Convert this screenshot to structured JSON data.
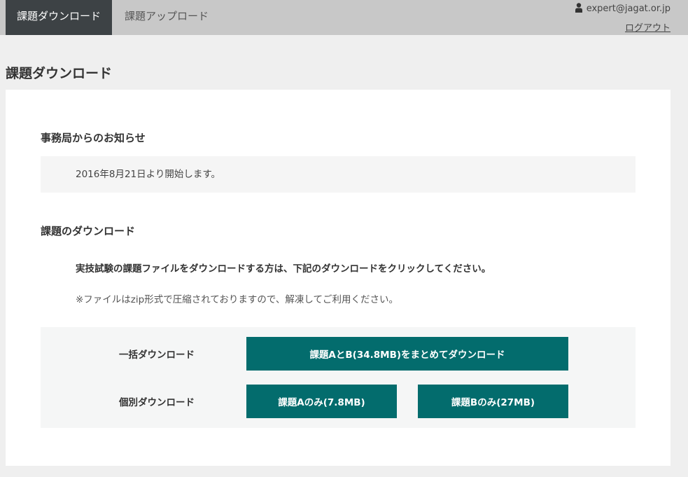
{
  "nav": {
    "tabs": [
      {
        "label": "課題ダウンロード",
        "active": true
      },
      {
        "label": "課題アップロード",
        "active": false
      }
    ],
    "user_icon": "user-icon",
    "user_email": "expert@jagat.or.jp",
    "logout_label": "ログアウト"
  },
  "page": {
    "title": "課題ダウンロード"
  },
  "notice_section": {
    "heading": "事務局からのお知らせ",
    "message": "2016年8月21日より開始します。"
  },
  "download_section": {
    "heading": "課題のダウンロード",
    "lead": "実技試験の課題ファイルをダウンロードする方は、下記のダウンロードをクリックしてください。",
    "note": "※ファイルはzip形式で圧縮されておりますので、解凍してご利用ください。",
    "bulk_label": "一括ダウンロード",
    "bulk_button": "課題AとB(34.8MB)をまとめてダウンロード",
    "individual_label": "個別ダウンロード",
    "button_a": "課題Aのみ(7.8MB)",
    "button_b": "課題Bのみ(27MB)"
  },
  "colors": {
    "button": "#036c6d",
    "nav_active": "#3d4245",
    "nav_bar": "#c8c8c8"
  }
}
